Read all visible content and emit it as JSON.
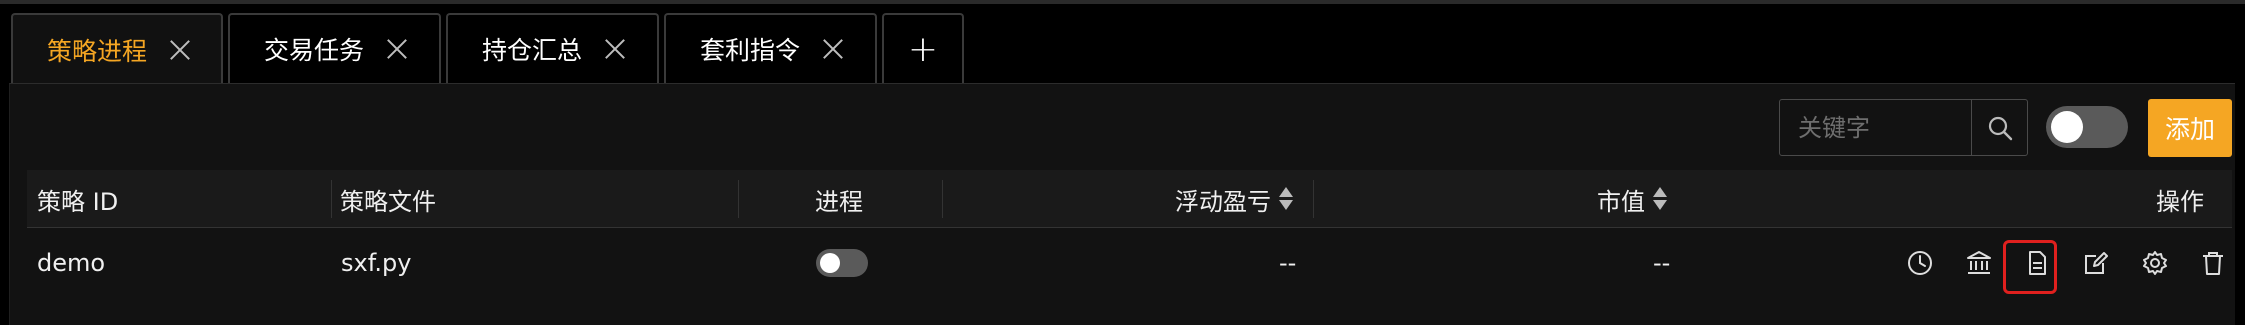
{
  "tabs": [
    {
      "label": "策略进程",
      "active": true
    },
    {
      "label": "交易任务",
      "active": false
    },
    {
      "label": "持仓汇总",
      "active": false
    },
    {
      "label": "套利指令",
      "active": false
    }
  ],
  "add_tab_label": "+",
  "toolbar": {
    "search_placeholder": "关键字",
    "add_label": "添加"
  },
  "table": {
    "headers": {
      "id": "策略 ID",
      "file": "策略文件",
      "process": "进程",
      "pnl": "浮动盈亏",
      "market_value": "市值",
      "actions": "操作"
    },
    "rows": [
      {
        "id": "demo",
        "file": "sxf.py",
        "process_on": false,
        "pnl": "--",
        "market_value": "--"
      }
    ],
    "row_actions": [
      "history-icon",
      "bank-icon",
      "document-icon",
      "edit-icon",
      "settings-icon",
      "trash-icon"
    ]
  },
  "colors": {
    "accent": "#f5a623",
    "background": "#000000",
    "panel": "#121212",
    "highlight": "#e0201e"
  }
}
